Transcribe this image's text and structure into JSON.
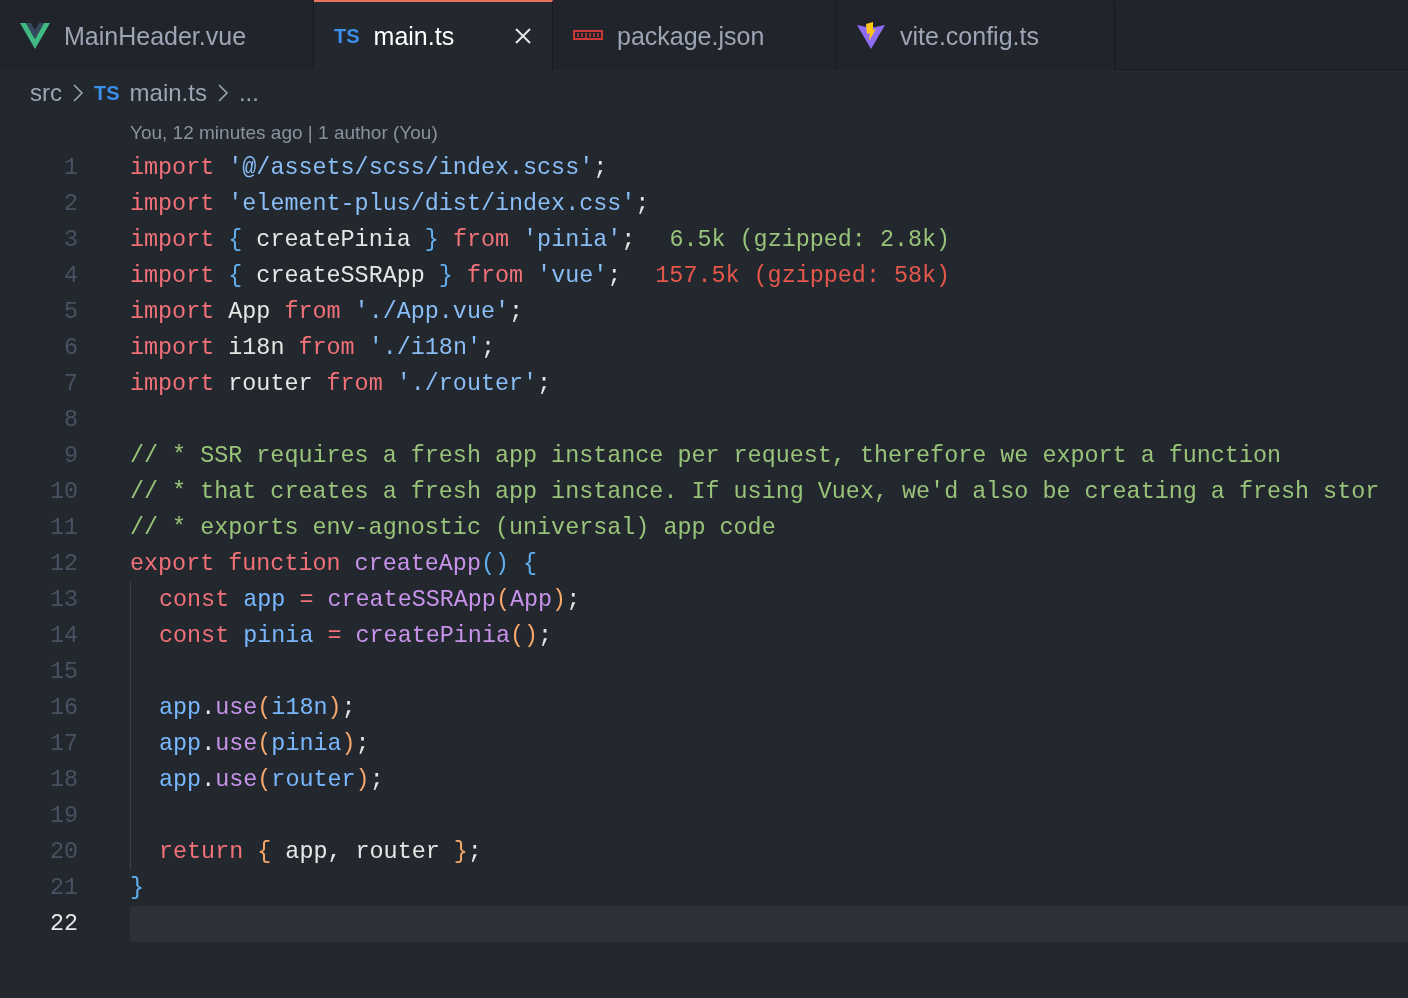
{
  "tabs": [
    {
      "label": "MainHeader.vue",
      "kind": "vue",
      "selected": false
    },
    {
      "label": "main.ts",
      "kind": "ts",
      "icon_text": "TS",
      "selected": true
    },
    {
      "label": "package.json",
      "kind": "npm",
      "selected": false
    },
    {
      "label": "vite.config.ts",
      "kind": "vite",
      "selected": false
    }
  ],
  "breadcrumb": [
    {
      "kind": "folder",
      "text": "src"
    },
    {
      "kind": "file",
      "icon_text": "TS",
      "text": "main.ts"
    },
    {
      "kind": "more",
      "text": "..."
    }
  ],
  "blame": "You, 12 minutes ago | 1 author (You)",
  "lines": [
    {
      "number": "1",
      "current": false,
      "tokens": [
        {
          "kind": "keyword",
          "text": "import "
        },
        {
          "kind": "string",
          "text": "'@/assets/scss/index.scss'"
        },
        {
          "kind": "plain",
          "text": ";"
        }
      ]
    },
    {
      "number": "2",
      "current": false,
      "tokens": [
        {
          "kind": "keyword",
          "text": "import "
        },
        {
          "kind": "string",
          "text": "'element-plus/dist/index.css'"
        },
        {
          "kind": "plain",
          "text": ";"
        }
      ]
    },
    {
      "number": "3",
      "current": false,
      "tokens": [
        {
          "kind": "keyword",
          "text": "import "
        },
        {
          "kind": "brace",
          "text": "{"
        },
        {
          "kind": "plain",
          "text": " createPinia "
        },
        {
          "kind": "brace",
          "text": "} "
        },
        {
          "kind": "keyword",
          "text": "from "
        },
        {
          "kind": "string",
          "text": "'pinia'"
        },
        {
          "kind": "plain",
          "text": ";"
        }
      ],
      "hint": {
        "kind": "ok",
        "text": "6.5k (gzipped: 2.8k)"
      }
    },
    {
      "number": "4",
      "current": false,
      "tokens": [
        {
          "kind": "keyword",
          "text": "import "
        },
        {
          "kind": "brace",
          "text": "{"
        },
        {
          "kind": "plain",
          "text": " createSSRApp "
        },
        {
          "kind": "brace",
          "text": "} "
        },
        {
          "kind": "keyword",
          "text": "from "
        },
        {
          "kind": "string",
          "text": "'vue'"
        },
        {
          "kind": "plain",
          "text": ";"
        }
      ],
      "hint": {
        "kind": "warn",
        "text": "157.5k (gzipped: 58k)"
      }
    },
    {
      "number": "5",
      "current": false,
      "tokens": [
        {
          "kind": "keyword",
          "text": "import"
        },
        {
          "kind": "plain",
          "text": " App "
        },
        {
          "kind": "keyword",
          "text": "from "
        },
        {
          "kind": "string",
          "text": "'./App.vue'"
        },
        {
          "kind": "plain",
          "text": ";"
        }
      ]
    },
    {
      "number": "6",
      "current": false,
      "tokens": [
        {
          "kind": "keyword",
          "text": "import"
        },
        {
          "kind": "plain",
          "text": " i18n "
        },
        {
          "kind": "keyword",
          "text": "from "
        },
        {
          "kind": "string",
          "text": "'./i18n'"
        },
        {
          "kind": "plain",
          "text": ";"
        }
      ]
    },
    {
      "number": "7",
      "current": false,
      "tokens": [
        {
          "kind": "keyword",
          "text": "import"
        },
        {
          "kind": "plain",
          "text": " router "
        },
        {
          "kind": "keyword",
          "text": "from "
        },
        {
          "kind": "string",
          "text": "'./router'"
        },
        {
          "kind": "plain",
          "text": ";"
        }
      ]
    },
    {
      "number": "8",
      "current": false
    },
    {
      "number": "9",
      "current": false,
      "tokens": [
        {
          "kind": "comment",
          "text": "// * SSR requires a fresh app instance per request, therefore we export a function"
        }
      ]
    },
    {
      "number": "10",
      "current": false,
      "tokens": [
        {
          "kind": "comment",
          "text": "// * that creates a fresh app instance. If using Vuex, we'd also be creating a fresh stor"
        }
      ]
    },
    {
      "number": "11",
      "current": false,
      "tokens": [
        {
          "kind": "comment",
          "text": "// * exports env-agnostic (universal) app code"
        }
      ]
    },
    {
      "number": "12",
      "current": false,
      "tokens": [
        {
          "kind": "keyword",
          "text": "export function "
        },
        {
          "kind": "func",
          "text": "createApp"
        },
        {
          "kind": "brace",
          "text": "() {"
        }
      ]
    },
    {
      "number": "13",
      "current": false,
      "guide": true,
      "tokens": [
        {
          "kind": "keyword",
          "text": "const "
        },
        {
          "kind": "var",
          "text": "app "
        },
        {
          "kind": "keyword",
          "text": "= "
        },
        {
          "kind": "func",
          "text": "createSSRApp"
        },
        {
          "kind": "paren",
          "text": "("
        },
        {
          "kind": "func",
          "text": "App"
        },
        {
          "kind": "paren",
          "text": ")"
        },
        {
          "kind": "plain",
          "text": ";"
        }
      ]
    },
    {
      "number": "14",
      "current": false,
      "guide": true,
      "tokens": [
        {
          "kind": "keyword",
          "text": "const "
        },
        {
          "kind": "var",
          "text": "pinia "
        },
        {
          "kind": "keyword",
          "text": "= "
        },
        {
          "kind": "func",
          "text": "createPinia"
        },
        {
          "kind": "paren",
          "text": "()"
        },
        {
          "kind": "plain",
          "text": ";"
        }
      ]
    },
    {
      "number": "15",
      "current": false,
      "guide": true
    },
    {
      "number": "16",
      "current": false,
      "guide": true,
      "tokens": [
        {
          "kind": "var",
          "text": "app"
        },
        {
          "kind": "plain",
          "text": "."
        },
        {
          "kind": "func",
          "text": "use"
        },
        {
          "kind": "paren",
          "text": "("
        },
        {
          "kind": "var",
          "text": "i18n"
        },
        {
          "kind": "paren",
          "text": ")"
        },
        {
          "kind": "plain",
          "text": ";"
        }
      ]
    },
    {
      "number": "17",
      "current": false,
      "guide": true,
      "tokens": [
        {
          "kind": "var",
          "text": "app"
        },
        {
          "kind": "plain",
          "text": "."
        },
        {
          "kind": "func",
          "text": "use"
        },
        {
          "kind": "paren",
          "text": "("
        },
        {
          "kind": "var",
          "text": "pinia"
        },
        {
          "kind": "paren",
          "text": ")"
        },
        {
          "kind": "plain",
          "text": ";"
        }
      ]
    },
    {
      "number": "18",
      "current": false,
      "guide": true,
      "tokens": [
        {
          "kind": "var",
          "text": "app"
        },
        {
          "kind": "plain",
          "text": "."
        },
        {
          "kind": "func",
          "text": "use"
        },
        {
          "kind": "paren",
          "text": "("
        },
        {
          "kind": "var",
          "text": "router"
        },
        {
          "kind": "paren",
          "text": ")"
        },
        {
          "kind": "plain",
          "text": ";"
        }
      ]
    },
    {
      "number": "19",
      "current": false,
      "guide": true
    },
    {
      "number": "20",
      "current": false,
      "guide": true,
      "tokens": [
        {
          "kind": "keyword",
          "text": "return "
        },
        {
          "kind": "paren",
          "text": "{"
        },
        {
          "kind": "plain",
          "text": " app, router "
        },
        {
          "kind": "paren",
          "text": "}"
        },
        {
          "kind": "plain",
          "text": ";"
        }
      ]
    },
    {
      "number": "21",
      "current": false,
      "tokens": [
        {
          "kind": "brace",
          "text": "}"
        }
      ]
    },
    {
      "number": "22",
      "current": true
    }
  ]
}
